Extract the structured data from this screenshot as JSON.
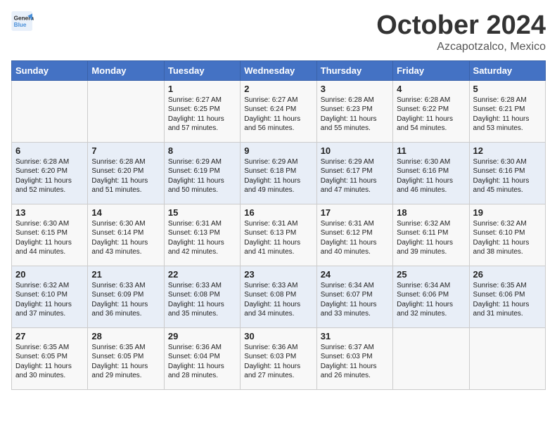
{
  "logo": {
    "line1": "General",
    "line2": "Blue"
  },
  "title": "October 2024",
  "subtitle": "Azcapotzalco, Mexico",
  "headers": [
    "Sunday",
    "Monday",
    "Tuesday",
    "Wednesday",
    "Thursday",
    "Friday",
    "Saturday"
  ],
  "weeks": [
    [
      {
        "day": "",
        "info": ""
      },
      {
        "day": "",
        "info": ""
      },
      {
        "day": "1",
        "info": "Sunrise: 6:27 AM\nSunset: 6:25 PM\nDaylight: 11 hours and 57 minutes."
      },
      {
        "day": "2",
        "info": "Sunrise: 6:27 AM\nSunset: 6:24 PM\nDaylight: 11 hours and 56 minutes."
      },
      {
        "day": "3",
        "info": "Sunrise: 6:28 AM\nSunset: 6:23 PM\nDaylight: 11 hours and 55 minutes."
      },
      {
        "day": "4",
        "info": "Sunrise: 6:28 AM\nSunset: 6:22 PM\nDaylight: 11 hours and 54 minutes."
      },
      {
        "day": "5",
        "info": "Sunrise: 6:28 AM\nSunset: 6:21 PM\nDaylight: 11 hours and 53 minutes."
      }
    ],
    [
      {
        "day": "6",
        "info": "Sunrise: 6:28 AM\nSunset: 6:20 PM\nDaylight: 11 hours and 52 minutes."
      },
      {
        "day": "7",
        "info": "Sunrise: 6:28 AM\nSunset: 6:20 PM\nDaylight: 11 hours and 51 minutes."
      },
      {
        "day": "8",
        "info": "Sunrise: 6:29 AM\nSunset: 6:19 PM\nDaylight: 11 hours and 50 minutes."
      },
      {
        "day": "9",
        "info": "Sunrise: 6:29 AM\nSunset: 6:18 PM\nDaylight: 11 hours and 49 minutes."
      },
      {
        "day": "10",
        "info": "Sunrise: 6:29 AM\nSunset: 6:17 PM\nDaylight: 11 hours and 47 minutes."
      },
      {
        "day": "11",
        "info": "Sunrise: 6:30 AM\nSunset: 6:16 PM\nDaylight: 11 hours and 46 minutes."
      },
      {
        "day": "12",
        "info": "Sunrise: 6:30 AM\nSunset: 6:16 PM\nDaylight: 11 hours and 45 minutes."
      }
    ],
    [
      {
        "day": "13",
        "info": "Sunrise: 6:30 AM\nSunset: 6:15 PM\nDaylight: 11 hours and 44 minutes."
      },
      {
        "day": "14",
        "info": "Sunrise: 6:30 AM\nSunset: 6:14 PM\nDaylight: 11 hours and 43 minutes."
      },
      {
        "day": "15",
        "info": "Sunrise: 6:31 AM\nSunset: 6:13 PM\nDaylight: 11 hours and 42 minutes."
      },
      {
        "day": "16",
        "info": "Sunrise: 6:31 AM\nSunset: 6:13 PM\nDaylight: 11 hours and 41 minutes."
      },
      {
        "day": "17",
        "info": "Sunrise: 6:31 AM\nSunset: 6:12 PM\nDaylight: 11 hours and 40 minutes."
      },
      {
        "day": "18",
        "info": "Sunrise: 6:32 AM\nSunset: 6:11 PM\nDaylight: 11 hours and 39 minutes."
      },
      {
        "day": "19",
        "info": "Sunrise: 6:32 AM\nSunset: 6:10 PM\nDaylight: 11 hours and 38 minutes."
      }
    ],
    [
      {
        "day": "20",
        "info": "Sunrise: 6:32 AM\nSunset: 6:10 PM\nDaylight: 11 hours and 37 minutes."
      },
      {
        "day": "21",
        "info": "Sunrise: 6:33 AM\nSunset: 6:09 PM\nDaylight: 11 hours and 36 minutes."
      },
      {
        "day": "22",
        "info": "Sunrise: 6:33 AM\nSunset: 6:08 PM\nDaylight: 11 hours and 35 minutes."
      },
      {
        "day": "23",
        "info": "Sunrise: 6:33 AM\nSunset: 6:08 PM\nDaylight: 11 hours and 34 minutes."
      },
      {
        "day": "24",
        "info": "Sunrise: 6:34 AM\nSunset: 6:07 PM\nDaylight: 11 hours and 33 minutes."
      },
      {
        "day": "25",
        "info": "Sunrise: 6:34 AM\nSunset: 6:06 PM\nDaylight: 11 hours and 32 minutes."
      },
      {
        "day": "26",
        "info": "Sunrise: 6:35 AM\nSunset: 6:06 PM\nDaylight: 11 hours and 31 minutes."
      }
    ],
    [
      {
        "day": "27",
        "info": "Sunrise: 6:35 AM\nSunset: 6:05 PM\nDaylight: 11 hours and 30 minutes."
      },
      {
        "day": "28",
        "info": "Sunrise: 6:35 AM\nSunset: 6:05 PM\nDaylight: 11 hours and 29 minutes."
      },
      {
        "day": "29",
        "info": "Sunrise: 6:36 AM\nSunset: 6:04 PM\nDaylight: 11 hours and 28 minutes."
      },
      {
        "day": "30",
        "info": "Sunrise: 6:36 AM\nSunset: 6:03 PM\nDaylight: 11 hours and 27 minutes."
      },
      {
        "day": "31",
        "info": "Sunrise: 6:37 AM\nSunset: 6:03 PM\nDaylight: 11 hours and 26 minutes."
      },
      {
        "day": "",
        "info": ""
      },
      {
        "day": "",
        "info": ""
      }
    ]
  ]
}
